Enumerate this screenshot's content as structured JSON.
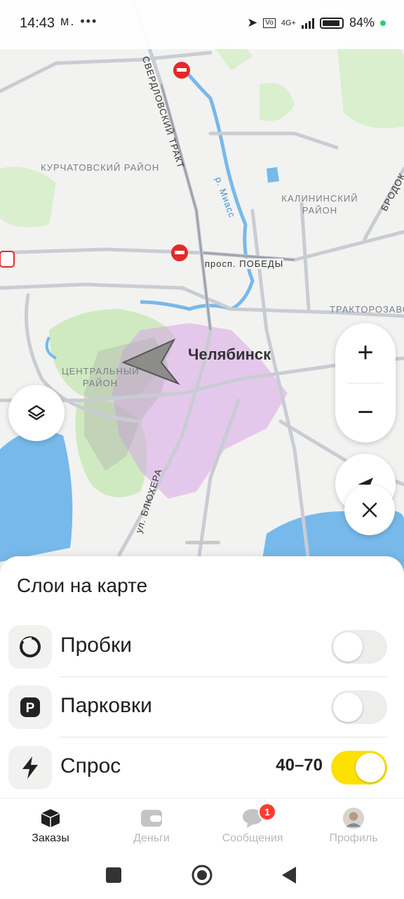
{
  "status_bar": {
    "time": "14:43",
    "left_icons": "м. •••",
    "network": "4G+",
    "battery_percent": "84%"
  },
  "map": {
    "city": "Челябинск",
    "districts": [
      "КУРЧАТОВСКИЙ РАЙОН",
      "КАЛИНИНСКИЙ РАЙОН",
      "ЦЕНТРАЛЬНЫЙ РАЙОН",
      "ТРАКТОРОЗАВО"
    ],
    "roads": [
      "СВЕРДЛОВСКИЙ ТРАКТ",
      "просп. ПОБЕДЫ",
      "ул. БЛЮХЕРА",
      "р. Миасс",
      "БРОДОК"
    ],
    "zoom_in_label": "+",
    "zoom_out_label": "−"
  },
  "sheet": {
    "title": "Слои на карте",
    "layers": [
      {
        "label": "Пробки",
        "icon": "traffic-icon",
        "enabled": false
      },
      {
        "label": "Парковки",
        "icon": "parking-icon",
        "enabled": false
      },
      {
        "label": "Спрос",
        "icon": "lightning-icon",
        "enabled": true,
        "range": "40–70"
      }
    ]
  },
  "tabbar": {
    "tabs": [
      {
        "label": "Заказы",
        "icon": "orders-box-icon",
        "active": true
      },
      {
        "label": "Деньги",
        "icon": "wallet-icon",
        "active": false
      },
      {
        "label": "Сообщения",
        "icon": "chat-icon",
        "active": false,
        "badge": "1"
      },
      {
        "label": "Профиль",
        "icon": "avatar-icon",
        "active": false
      }
    ]
  },
  "colors": {
    "accent_yellow": "#fce000",
    "demand_purple": "#d8a6e8",
    "badge_red": "#ff3b30",
    "water_blue": "#76b9ea",
    "park_green": "#cfeac0"
  }
}
